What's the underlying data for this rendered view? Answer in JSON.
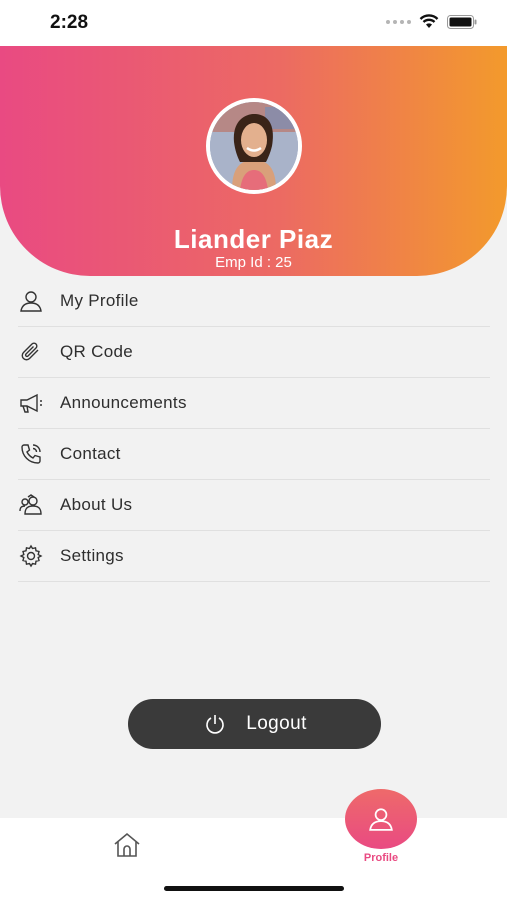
{
  "status_bar": {
    "time": "2:28",
    "icons": [
      "signal-dots-icon",
      "wifi-icon",
      "battery-icon"
    ]
  },
  "profile": {
    "name": "Liander Piaz",
    "emp_id": "Emp Id : 25"
  },
  "menu": {
    "items": [
      {
        "label": "My Profile",
        "icon": "user-icon"
      },
      {
        "label": "QR Code",
        "icon": "paperclip-icon"
      },
      {
        "label": "Announcements",
        "icon": "megaphone-icon"
      },
      {
        "label": "Contact",
        "icon": "phone-icon"
      },
      {
        "label": "About Us",
        "icon": "group-icon"
      },
      {
        "label": "Settings",
        "icon": "gear-icon"
      }
    ]
  },
  "logout": {
    "label": "Logout",
    "icon": "power-icon"
  },
  "tabbar": {
    "home_icon": "home-icon",
    "profile_label": "Profile",
    "profile_icon": "user-icon"
  },
  "colors": {
    "gradient_start": "#e94a82",
    "gradient_end": "#f39a2c",
    "logout_bg": "#3a3a3a",
    "accent": "#e94a82"
  }
}
